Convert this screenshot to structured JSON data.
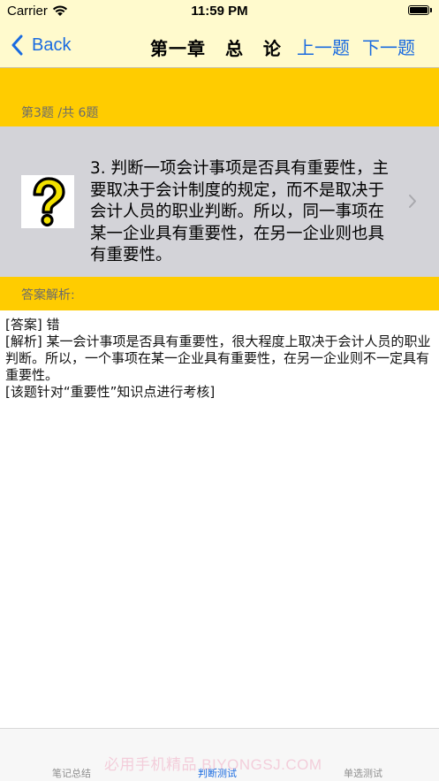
{
  "status_bar": {
    "carrier": "Carrier",
    "time": "11:59 PM",
    "wifi_icon": "wifi-icon",
    "battery_icon": "battery-full-icon"
  },
  "nav": {
    "back_label": "Back",
    "back_icon": "chevron-left-icon",
    "title": "第一章 总 论",
    "prev_label": "上一题",
    "next_label": "下一题",
    "link_color": "#1a6be0"
  },
  "question": {
    "counter": "第3题 /共 6题",
    "text": "3.  判断一项会计事项是否具有重要性，主要取决于会计制度的规定，而不是取决于会计人员的职业判断。所以，同一事项在某一企业具有重要性，在另一企业则也具有重要性。",
    "image_icon": "question-mark-icon",
    "chevron_icon": "chevron-right-icon"
  },
  "answer": {
    "section_label": "答案解析:",
    "lines": [
      "[答案] 错",
      "[解析] 某一会计事项是否具有重要性，很大程度上取决于会计人员的职业判断。所以，一个事项在某一企业具有重要性，在另一企业则不一定具有重要性。",
      "[该题针对“重要性”知识点进行考核]"
    ]
  },
  "tabs": [
    {
      "label": "笔记总结",
      "active": false
    },
    {
      "label": "判断测试",
      "active": true
    },
    {
      "label": "单选测试",
      "active": false
    }
  ],
  "watermark": "必用手机精品 BIYONGSJ.COM",
  "colors": {
    "accent_yellow": "#ffcc00",
    "nav_background": "#fffacd",
    "question_background": "#d3d3d8"
  }
}
